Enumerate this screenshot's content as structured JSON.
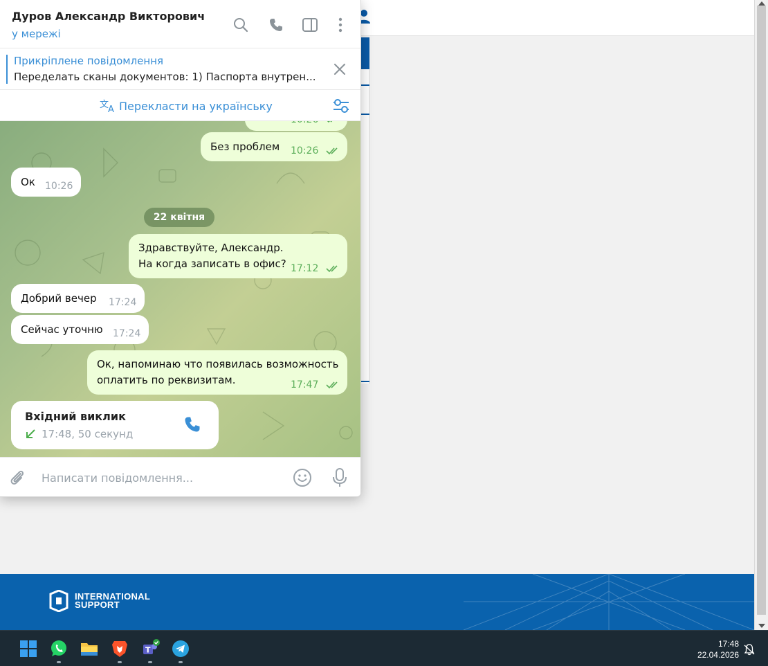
{
  "chat": {
    "contact_name": "Дуров Александр Викторович",
    "contact_status": "у мережі",
    "pinned": {
      "title": "Прикріплене повідомлення",
      "text": "Переделать сканы документов:  1) Паспорта внутрен..."
    },
    "translate_label": "Перекласти на українську",
    "messages": [
      {
        "direction": "out",
        "text": "Без проблем",
        "time": "10:26",
        "read": true
      },
      {
        "direction": "in",
        "text": "Ок",
        "time": "10:26"
      },
      {
        "direction": "out",
        "lines": [
          "Здравствуйте, Александр.",
          "На когда записать в офис?"
        ],
        "time": "17:12",
        "read": true
      },
      {
        "direction": "in",
        "text": "Добрий вечер",
        "time": "17:24"
      },
      {
        "direction": "in",
        "text": "Сейчас уточню",
        "time": "17:24"
      },
      {
        "direction": "out",
        "lines": [
          "Ок, напоминаю что появилась возможность",
          "оплатить по реквизитам."
        ],
        "time": "17:47",
        "read": true
      }
    ],
    "date_separator": "22 квітня",
    "partial_time": "10:26",
    "call": {
      "title": "Вхідний виклик",
      "meta": "17:48, 50 секунд"
    },
    "composer_placeholder": "Написати повідомлення..."
  },
  "footer": {
    "logo_line1": "INTERNATIONAL",
    "logo_line2": "SUPPORT"
  },
  "taskbar": {
    "apps": [
      "windows-start",
      "whatsapp",
      "file-explorer",
      "brave",
      "teams",
      "telegram"
    ],
    "time": "17:48",
    "date": "22.04.2026"
  },
  "colors": {
    "accent": "#3a8fd6",
    "outgoing_bubble": "#eefed9",
    "read_ticks": "#5cae5a",
    "footer_blue": "#0a62ad",
    "taskbar": "#1c2a34"
  }
}
